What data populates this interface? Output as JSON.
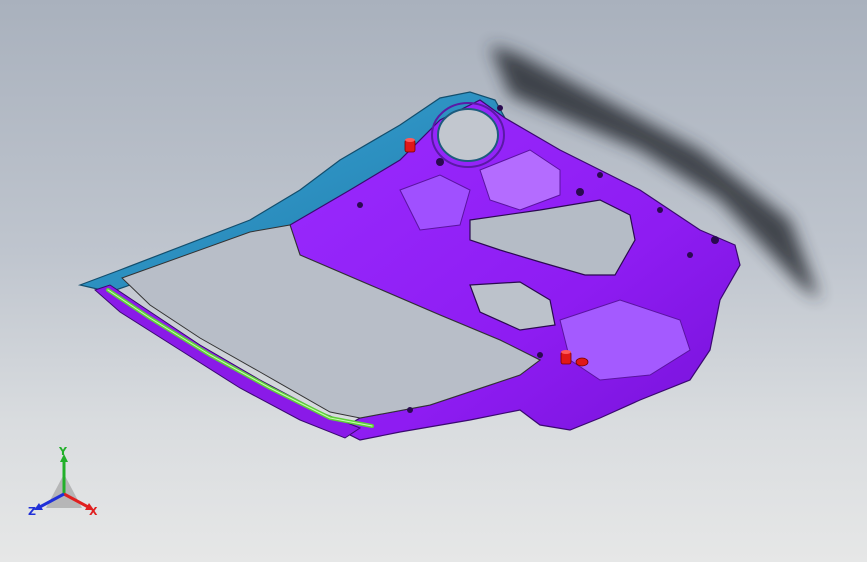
{
  "viewport": {
    "background_top": "#a9b1bd",
    "background_bottom": "#e6e7e7"
  },
  "model": {
    "part": "door-inner-panel",
    "colors": {
      "panel_body": "#8e1cf2",
      "panel_dark": "#6a12c4",
      "panel_light": "#b46cff",
      "upper_frame": "#2b93c9",
      "upper_frame_dark": "#1d6f9a",
      "seal_strip": "#5fcf3a",
      "fastener": "#e01818",
      "shadow": "#2a2f36"
    }
  },
  "triad": {
    "x_label": "X",
    "y_label": "Y",
    "z_label": "Z",
    "x_color": "#e02020",
    "y_color": "#22b02a",
    "z_color": "#2030d8"
  }
}
